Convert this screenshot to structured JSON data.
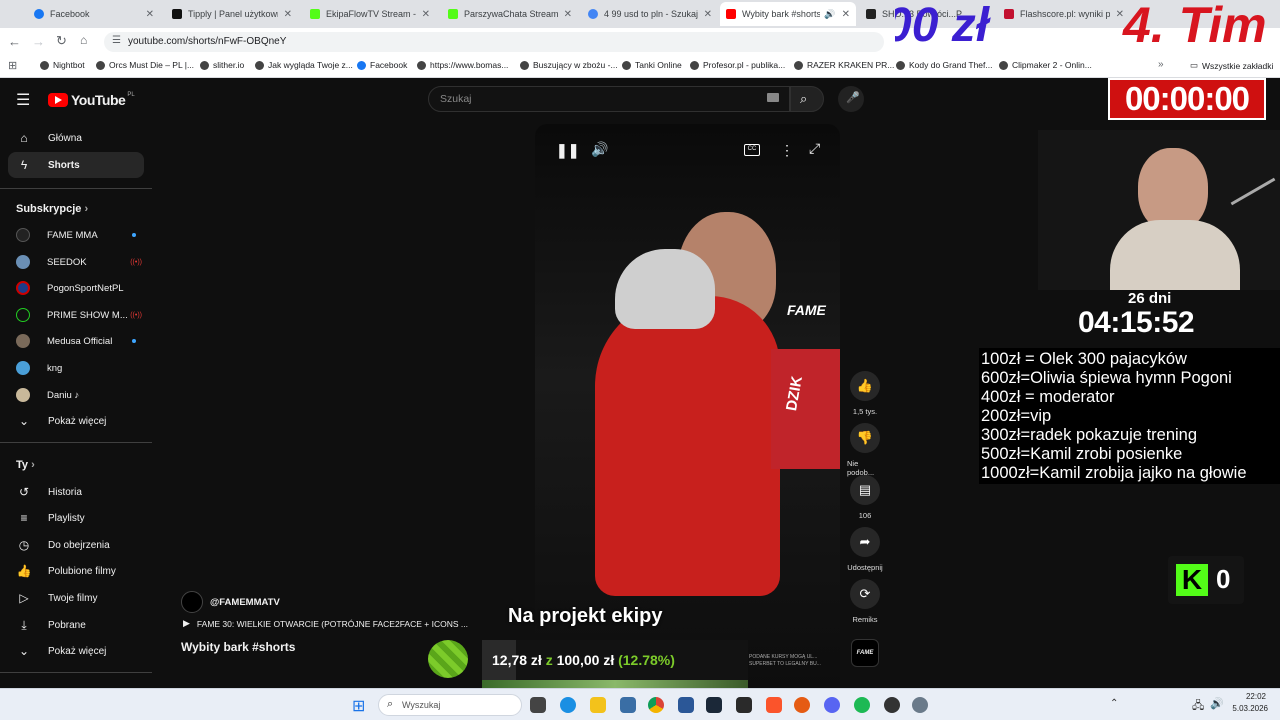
{
  "browser": {
    "tabs": [
      {
        "label": "Facebook",
        "color": "#1877f2"
      },
      {
        "label": "Tipply | Panel użytkownika",
        "color": "#111111"
      },
      {
        "label": "EkipaFlowTV Stream - Wat",
        "color": "#53fc18"
      },
      {
        "label": "ParszywaChata Stream - W",
        "color": "#53fc18"
      },
      {
        "label": "4 99 usd to pln - Szukaj w",
        "color": "#4285f4"
      },
      {
        "label": "Wybity bark #shorts",
        "color": "#ff0000",
        "active": true
      },
      {
        "label": "SHO...3 Powróci...P...",
        "color": "#222222"
      },
      {
        "label": "Flashscore.pl: wyniki piłk",
        "color": "#c2102f"
      }
    ],
    "address": "youtube.com/shorts/nFwF-OBQneY",
    "bookmarks": [
      "Nightbot",
      "Orcs Must Die – PL |...",
      "slither.io",
      "Jak wygląda Twoje z...",
      "Facebook",
      "https://www.bomas...",
      "Buszujący w zbożu -...",
      "Tanki Online",
      "Profesor.pl - publika...",
      "RAZER KRAKEN PR...",
      "Kody do Grand Thef...",
      "Clipmaker 2 - Onlin..."
    ],
    "all_bookmarks": "Wszystkie zakładki"
  },
  "youtube": {
    "logo": "YouTube",
    "region": "PL",
    "search_placeholder": "Szukaj",
    "nav": {
      "home": "Główna",
      "shorts": "Shorts"
    },
    "subs_title": "Subskrypcje",
    "subscriptions": [
      "FAME MMA",
      "SEEDOK",
      "PogonSportNetPL",
      "PRIME SHOW M...",
      "Medusa Official",
      "kng",
      "Daniu ♪"
    ],
    "show_more": "Pokaż więcej",
    "you_title": "Ty",
    "you_items": [
      "Historia",
      "Playlisty",
      "Do obejrzenia",
      "Polubione filmy",
      "Twoje filmy",
      "Pobrane",
      "Pokaż więcej"
    ],
    "short": {
      "channel": "@FAMEMMATV",
      "playlist": "FAME 30: WIELKIE OTWARCIE (POTRÓJNE FACE2FACE + ICONS ...",
      "title": "Wybity bark #shorts",
      "likes": "1,5 tys.",
      "dislike": "Nie podob...",
      "comments": "106",
      "share": "Udostępnij",
      "remix": "Remiks",
      "fame_logo": "FAME",
      "can_text": "DZIK",
      "sponsor_text": "PODANE KURSY MOGĄ UL... SUPERBET TO LEGALNY BU..."
    }
  },
  "stream_overlay": {
    "donation_amount": "00 zł",
    "subathon_text": "4. Tim",
    "timer": "00:00:00",
    "days": "26 dni",
    "countdown": "04:15:52",
    "rules": [
      "100zł = Olek 300 pajacyków",
      "600zł=Oliwia śpiewa hymn Pogoni",
      "400zł = moderator",
      "200zł=vip",
      "300zł=radek pokazuje trening",
      "500zł=Kamil zrobi posienke",
      "1000zł=Kamil zrobija jajko na głowie"
    ],
    "goal_label": "Na projekt ekipy",
    "goal_current": "12,78 zł",
    "goal_sep": "z",
    "goal_target": "100,00 zł",
    "goal_percent": "(12.78%)",
    "goal_progress": 12.78,
    "kick_count": "0"
  },
  "taskbar": {
    "search": "Wyszukaj",
    "time": "22:02",
    "date": "5.03.2026"
  }
}
